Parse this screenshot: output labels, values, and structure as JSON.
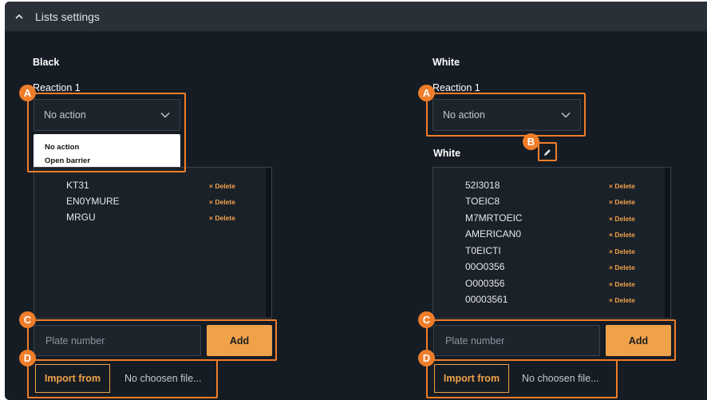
{
  "header": {
    "title": "Lists settings"
  },
  "black": {
    "title": "Black",
    "reaction_label": "Reaction 1",
    "reaction_value": "No action",
    "dropdown_options": [
      "No action",
      "Open barrier"
    ],
    "plates": [
      {
        "number": "KT31",
        "action": "× Delete"
      },
      {
        "number": "EN0YMURE",
        "action": "× Delete"
      },
      {
        "number": "MRGU",
        "action": "× Delete"
      }
    ],
    "plate_placeholder": "Plate number",
    "add_label": "Add",
    "import_label": "Import from",
    "file_label": "No choosen file..."
  },
  "white": {
    "title": "White",
    "reaction_label": "Reaction 1",
    "reaction_value": "No action",
    "list_title": "White",
    "plates": [
      {
        "number": "52I3018",
        "action": "× Delete"
      },
      {
        "number": "TOEIC8",
        "action": "× Delete"
      },
      {
        "number": "M7MRTOEIC",
        "action": "× Delete"
      },
      {
        "number": "AMERICAN0",
        "action": "× Delete"
      },
      {
        "number": "T0EICTI",
        "action": "× Delete"
      },
      {
        "number": "00O0356",
        "action": "× Delete"
      },
      {
        "number": "O000356",
        "action": "× Delete"
      },
      {
        "number": "00003561",
        "action": "× Delete"
      }
    ],
    "plate_placeholder": "Plate number",
    "add_label": "Add",
    "import_label": "Import from",
    "file_label": "No choosen file..."
  },
  "badges": {
    "a": "A",
    "b": "B",
    "c": "C",
    "d": "D"
  },
  "colors": {
    "accent": "#f0a24a",
    "highlight": "#ef7d2a",
    "background": "#161c24",
    "header": "#2a3038"
  },
  "icons": {
    "collapse": "chevron-up-icon",
    "select": "chevron-down-icon",
    "edit": "pencil-icon"
  }
}
